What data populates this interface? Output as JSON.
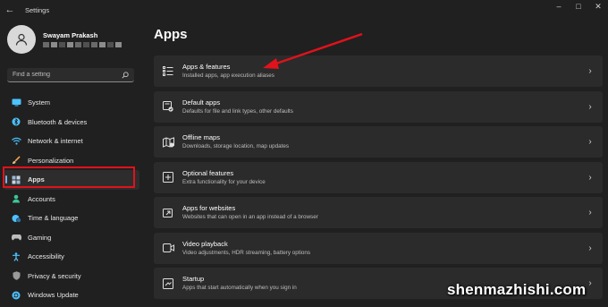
{
  "window": {
    "title": "Settings",
    "back_icon": "back-arrow-icon",
    "controls": [
      "minimize-icon",
      "maximize-icon",
      "close-icon"
    ]
  },
  "profile": {
    "name": "Swayam Prakash",
    "avatar_icon": "person-icon"
  },
  "search": {
    "placeholder": "Find a setting",
    "icon": "search-icon"
  },
  "sidebar": {
    "items": [
      {
        "label": "System",
        "icon": "monitor-icon",
        "color": "#4cc2ff"
      },
      {
        "label": "Bluetooth & devices",
        "icon": "bluetooth-icon",
        "color": "#4cc2ff"
      },
      {
        "label": "Network & internet",
        "icon": "wifi-icon",
        "color": "#4cc2ff"
      },
      {
        "label": "Personalization",
        "icon": "brush-icon",
        "color": "#f0a14a"
      },
      {
        "label": "Apps",
        "icon": "apps-icon",
        "color": "#9bb8d6",
        "selected": true
      },
      {
        "label": "Accounts",
        "icon": "person-icon",
        "color": "#3ec49a"
      },
      {
        "label": "Time & language",
        "icon": "clock-globe-icon",
        "color": "#4cc2ff"
      },
      {
        "label": "Gaming",
        "icon": "gamepad-icon",
        "color": "#bdbdbd"
      },
      {
        "label": "Accessibility",
        "icon": "accessibility-icon",
        "color": "#4cc2ff"
      },
      {
        "label": "Privacy & security",
        "icon": "shield-icon",
        "color": "#9a9a9a"
      },
      {
        "label": "Windows Update",
        "icon": "update-icon",
        "color": "#4cc2ff"
      }
    ]
  },
  "main": {
    "title": "Apps",
    "cards": [
      {
        "title": "Apps & features",
        "subtitle": "Installed apps, app execution aliases",
        "icon": "list-icon"
      },
      {
        "title": "Default apps",
        "subtitle": "Defaults for file and link types, other defaults",
        "icon": "default-apps-icon"
      },
      {
        "title": "Offline maps",
        "subtitle": "Downloads, storage location, map updates",
        "icon": "map-icon"
      },
      {
        "title": "Optional features",
        "subtitle": "Extra functionality for your device",
        "icon": "add-box-icon"
      },
      {
        "title": "Apps for websites",
        "subtitle": "Websites that can open in an app instead of a browser",
        "icon": "open-in-app-icon"
      },
      {
        "title": "Video playback",
        "subtitle": "Video adjustments, HDR streaming, battery options",
        "icon": "video-icon"
      },
      {
        "title": "Startup",
        "subtitle": "Apps that start automatically when you sign in",
        "icon": "startup-icon"
      }
    ]
  },
  "annotations": {
    "highlight_color": "#e0121b",
    "arrow_color": "#e0121b"
  },
  "watermark": "shenmazhishi.com"
}
